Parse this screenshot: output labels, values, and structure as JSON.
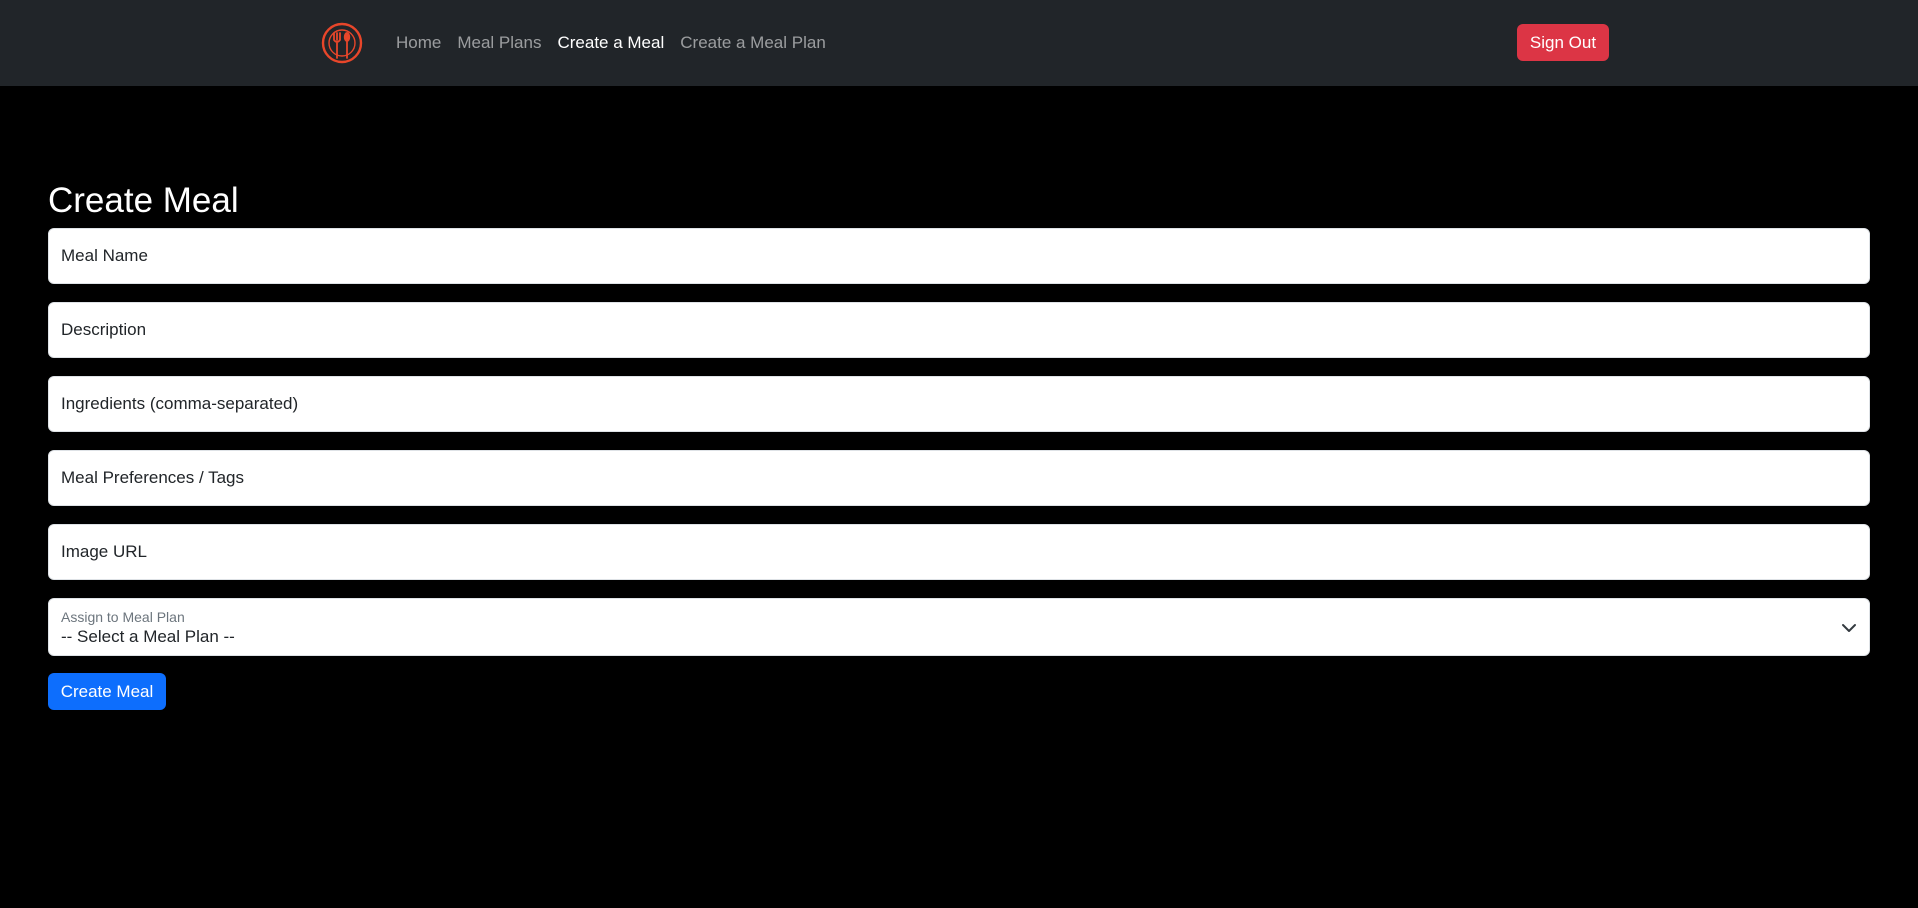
{
  "colors": {
    "navbar_bg": "#212529",
    "page_bg": "#000000",
    "brand_accent": "#e8462a",
    "danger": "#dc3545",
    "primary": "#0d6efd"
  },
  "navbar": {
    "brand_icon": "fork-spoon-plate-logo-icon",
    "links": [
      {
        "label": "Home",
        "active": false
      },
      {
        "label": "Meal Plans",
        "active": false
      },
      {
        "label": "Create a Meal",
        "active": true
      },
      {
        "label": "Create a Meal Plan",
        "active": false
      }
    ],
    "signout_label": "Sign Out"
  },
  "form": {
    "title": "Create Meal",
    "meal_name": {
      "placeholder": "Meal Name",
      "value": ""
    },
    "description": {
      "placeholder": "Description",
      "value": ""
    },
    "ingredients": {
      "placeholder": "Ingredients (comma-separated)",
      "value": ""
    },
    "tags": {
      "placeholder": "Meal Preferences / Tags",
      "value": ""
    },
    "image_url": {
      "placeholder": "Image URL",
      "value": ""
    },
    "meal_plan_select": {
      "label": "Assign to Meal Plan",
      "selected": "-- Select a Meal Plan --",
      "icon": "chevron-down-icon"
    },
    "submit_label": "Create Meal"
  }
}
